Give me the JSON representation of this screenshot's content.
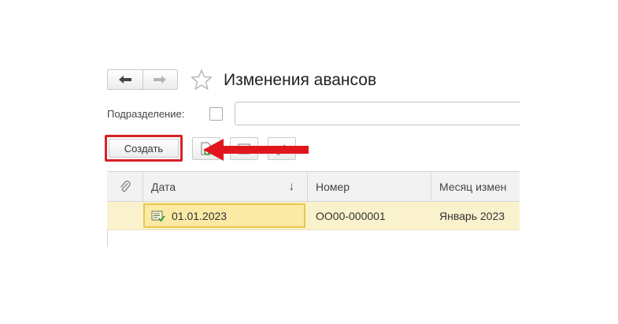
{
  "header": {
    "title": "Изменения авансов",
    "back_icon": "arrow-left-icon",
    "forward_icon": "arrow-right-icon",
    "favorite_icon": "star-icon"
  },
  "filter": {
    "label": "Подразделение:",
    "checked": false,
    "value": ""
  },
  "toolbar": {
    "create_label": "Создать",
    "buttons": [
      "copy-document-icon",
      "list-icon",
      "edit-icon"
    ],
    "highlight_color": "#d62229"
  },
  "table": {
    "columns": [
      {
        "label": "",
        "icon": "paperclip-icon"
      },
      {
        "label": "Дата",
        "sort": "↓"
      },
      {
        "label": "Номер"
      },
      {
        "label": "Месяц измен"
      }
    ],
    "rows": [
      {
        "date": "01.01.2023",
        "number": "ОО00-000001",
        "month": "Январь 2023",
        "status_icon": "posted-document-icon"
      }
    ],
    "selected_row_color": "#faf2cc"
  }
}
